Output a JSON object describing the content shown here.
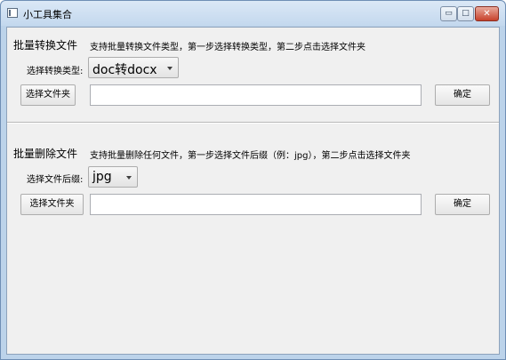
{
  "window": {
    "title": "小工具集合",
    "minimize_label": "▭",
    "maximize_label": "□",
    "close_label": "✕"
  },
  "convert": {
    "heading": "批量转换文件",
    "description": "支持批量转换文件类型，第一步选择转换类型，第二步点击选择文件夹",
    "type_label": "选择转换类型:",
    "type_selected": "doc转docx",
    "choose_folder_label": "选择文件夹",
    "path_value": "",
    "confirm_label": "确定"
  },
  "delete": {
    "heading": "批量删除文件",
    "description": "支持批量删除任何文件，第一步选择文件后缀（例：jpg），第二步点击选择文件夹",
    "suffix_label": "选择文件后缀:",
    "suffix_selected": "jpg",
    "choose_folder_label": "选择文件夹",
    "path_value": "",
    "confirm_label": "确定"
  }
}
